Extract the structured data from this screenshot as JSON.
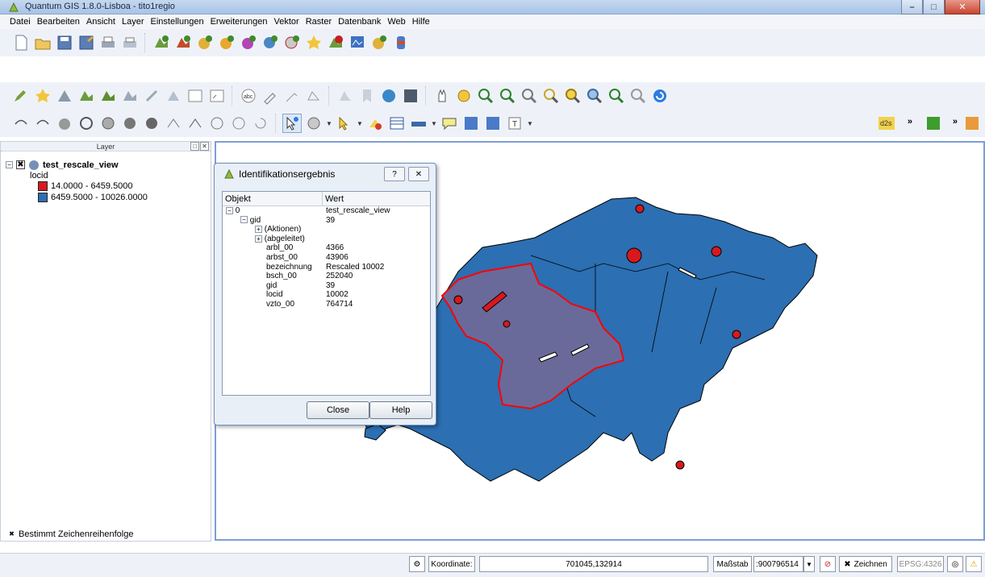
{
  "window": {
    "title": "Quantum GIS 1.8.0-Lisboa - tito1regio"
  },
  "menu": [
    "Datei",
    "Bearbeiten",
    "Ansicht",
    "Layer",
    "Einstellungen",
    "Erweiterungen",
    "Vektor",
    "Raster",
    "Datenbank",
    "Web",
    "Hilfe"
  ],
  "layer_panel": {
    "title": "Layer",
    "layer_name": "test_rescale_view",
    "field": "locid",
    "classes": [
      {
        "label": "14.0000 - 6459.5000",
        "color": "#d7191c"
      },
      {
        "label": "6459.5000 - 10026.0000",
        "color": "#2c6fb2"
      }
    ],
    "render_order_label": "Bestimmt Zeichenreihenfolge"
  },
  "identify": {
    "title": "Identifikationsergebnis",
    "col_object": "Objekt",
    "col_value": "Wert",
    "rows": [
      {
        "k": "0",
        "v": "test_rescale_view"
      },
      {
        "k": "gid",
        "v": "39"
      },
      {
        "k": "(Aktionen)",
        "v": ""
      },
      {
        "k": "(abgeleitet)",
        "v": ""
      },
      {
        "k": "arbl_00",
        "v": "4366"
      },
      {
        "k": "arbst_00",
        "v": "43906"
      },
      {
        "k": "bezeichnung",
        "v": "Rescaled 10002"
      },
      {
        "k": "bsch_00",
        "v": "252040"
      },
      {
        "k": "gid",
        "v": "39"
      },
      {
        "k": "locid",
        "v": "10002"
      },
      {
        "k": "vzto_00",
        "v": "764714"
      }
    ],
    "close_label": "Close",
    "help_label": "Help"
  },
  "status": {
    "coord_label": "Koordinate:",
    "coord_value": "701045,132914",
    "scale_label": "Maßstab",
    "scale_value": ":900796514",
    "render_label": "Zeichnen",
    "crs": "EPSG:4326"
  },
  "colors": {
    "accent": "#7d9ed6",
    "region_fill": "#2c6fb2",
    "selected_fill": "#6a6a9a",
    "selected_stroke": "#ff0000",
    "low_class": "#d7191c"
  }
}
